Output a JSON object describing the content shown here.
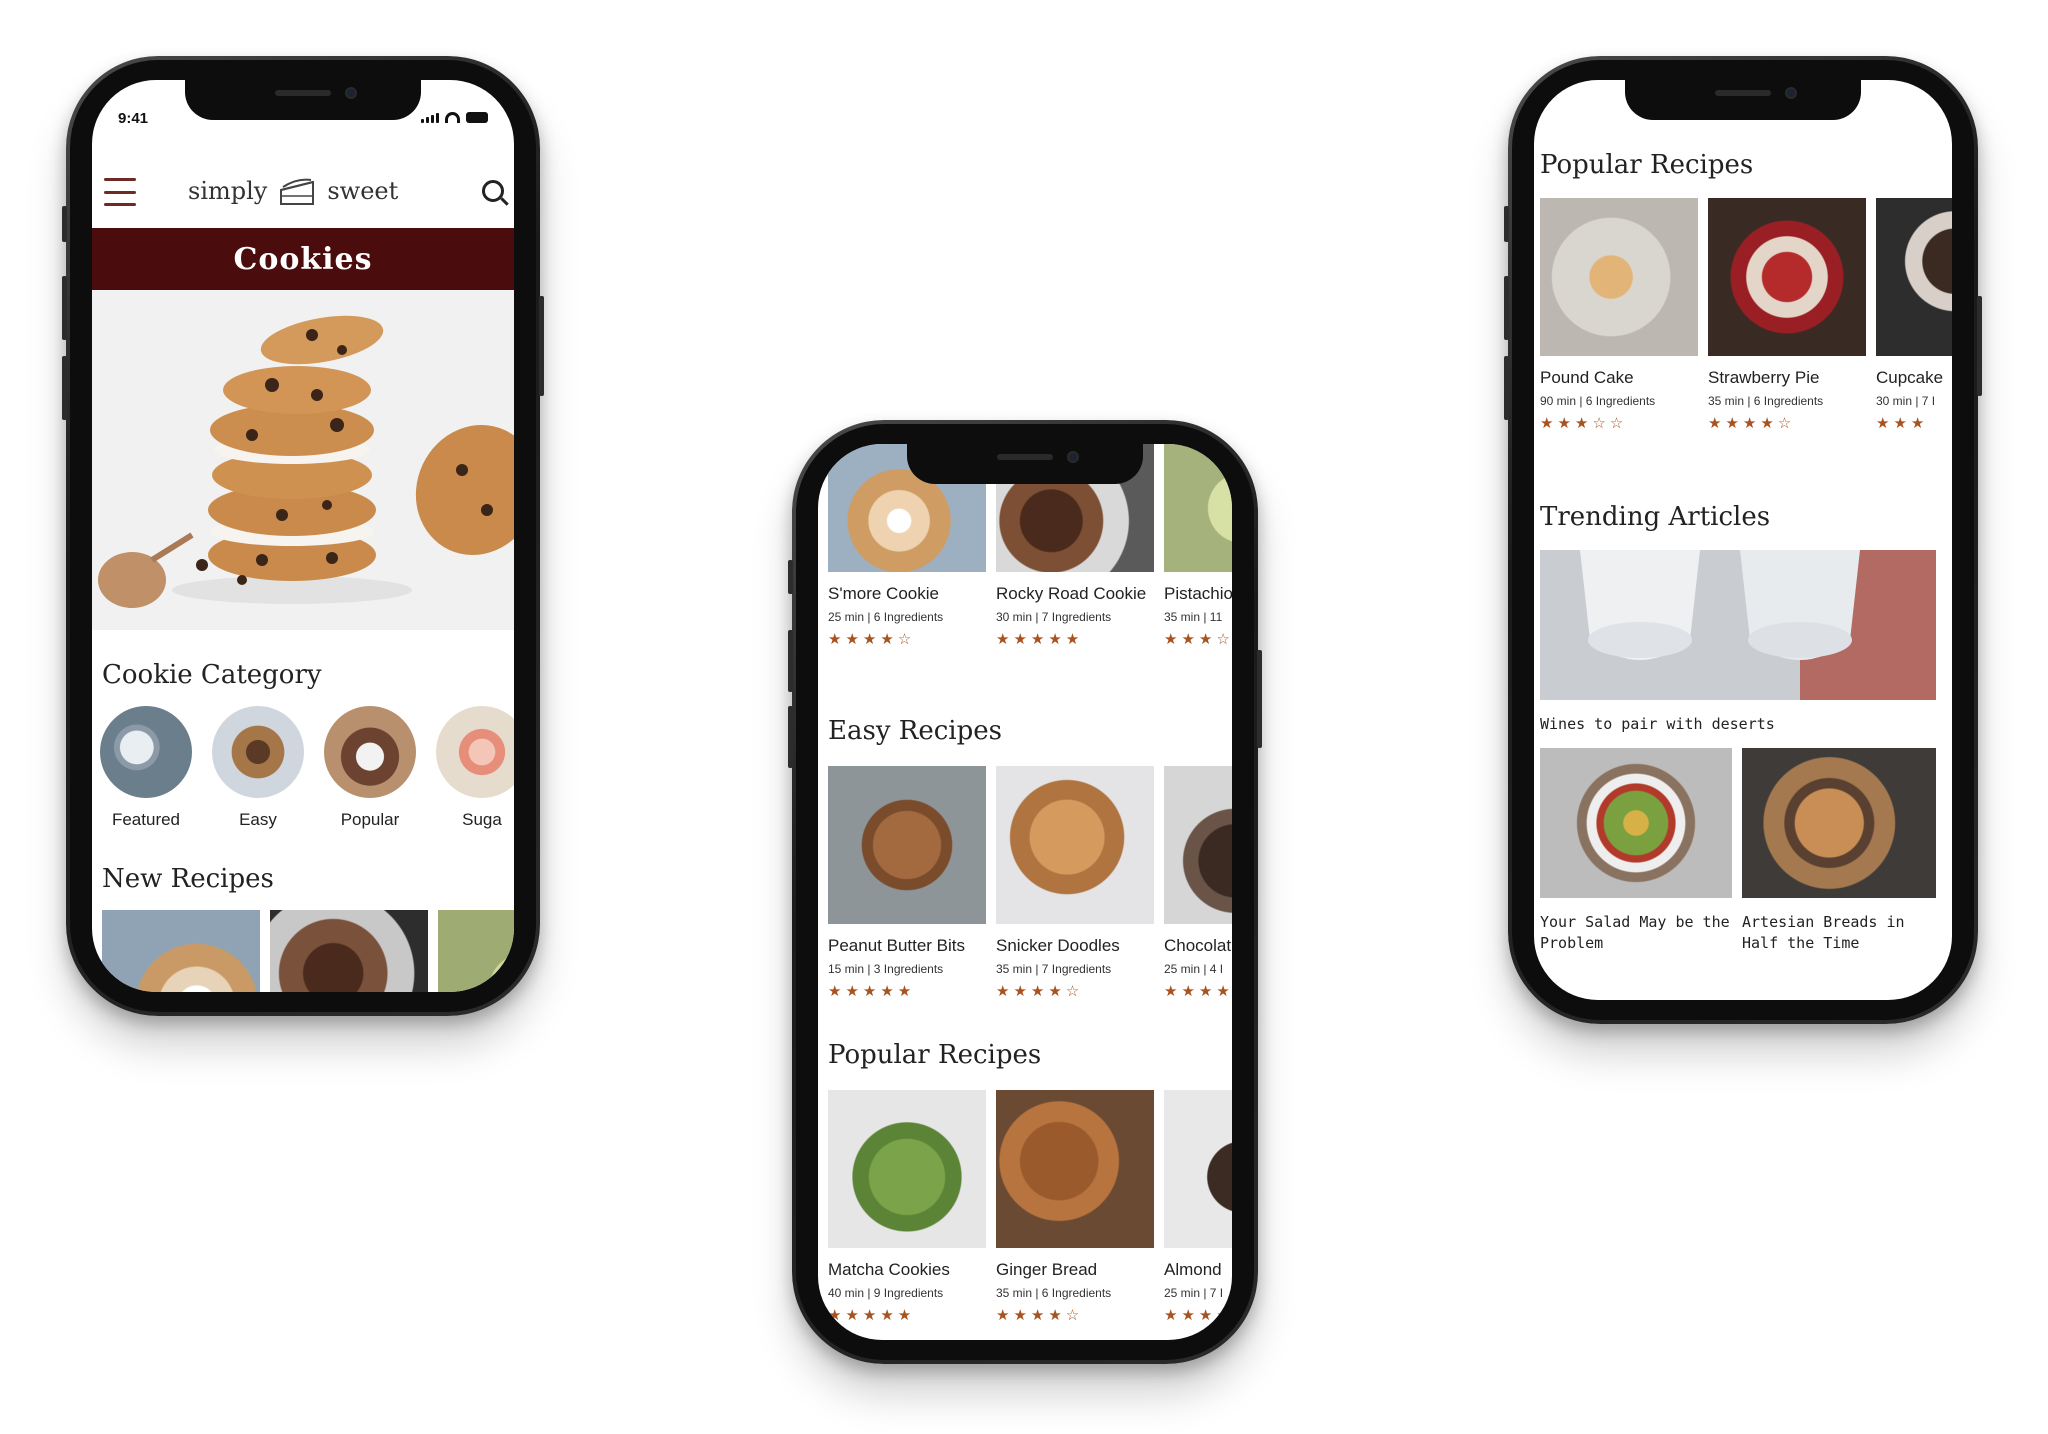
{
  "colors": {
    "brand_dark": "#4a0c0c",
    "accent": "#a8531f",
    "menu": "#6e2a24"
  },
  "phone1": {
    "status_time": "9:41",
    "brand_left": "simply",
    "brand_right": "sweet",
    "page_title": "Cookies",
    "category_heading": "Cookie Category",
    "categories": [
      {
        "label": "Featured"
      },
      {
        "label": "Easy"
      },
      {
        "label": "Popular"
      },
      {
        "label": "Suga"
      }
    ],
    "new_heading": "New Recipes"
  },
  "phone2": {
    "top_row": [
      {
        "name": "S'more Cookie",
        "meta": "25 min | 6 Ingredients",
        "stars": "★★★★☆"
      },
      {
        "name": "Rocky Road Cookie",
        "meta": "30 min | 7 Ingredients",
        "stars": "★★★★★"
      },
      {
        "name": "Pistachio",
        "meta": "35 min | 11",
        "stars": "★★★☆"
      }
    ],
    "easy_heading": "Easy Recipes",
    "easy": [
      {
        "name": "Peanut Butter Bits",
        "meta": "15 min | 3 Ingredients",
        "stars": "★★★★★"
      },
      {
        "name": "Snicker Doodles",
        "meta": "35 min | 7 Ingredients",
        "stars": "★★★★☆"
      },
      {
        "name": "Chocolat",
        "meta": "25 min | 4 I",
        "stars": "★★★★"
      }
    ],
    "popular_heading": "Popular Recipes",
    "popular": [
      {
        "name": "Matcha Cookies",
        "meta": "40 min | 9 Ingredients",
        "stars": "★★★★★"
      },
      {
        "name": "Ginger Bread",
        "meta": "35 min | 6 Ingredients",
        "stars": "★★★★☆"
      },
      {
        "name": "Almond",
        "meta": "25 min | 7 I",
        "stars": "★★★★"
      }
    ]
  },
  "phone3": {
    "popular_heading": "Popular Recipes",
    "popular": [
      {
        "name": "Pound Cake",
        "meta": "90 min | 6 Ingredients",
        "stars": "★★★☆☆"
      },
      {
        "name": "Strawberry Pie",
        "meta": "35 min | 6 Ingredients",
        "stars": "★★★★☆"
      },
      {
        "name": "Cupcake",
        "meta": "30 min | 7 I",
        "stars": "★★★"
      }
    ],
    "articles_heading": "Trending Articles",
    "articles": [
      {
        "caption": "Wines to pair with deserts"
      },
      {
        "caption": "Your Salad May be the Problem"
      },
      {
        "caption": "Artesian Breads in Half the Time"
      }
    ]
  }
}
